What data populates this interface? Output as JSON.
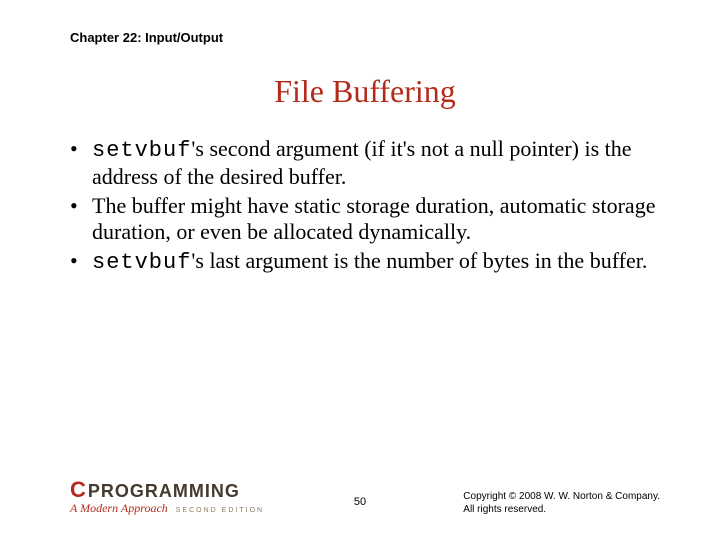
{
  "chapter_label": "Chapter 22: Input/Output",
  "title": "File Buffering",
  "bullets": [
    {
      "code1": "setvbuf",
      "rest1": "'s second argument (if it's not a null pointer) is the address of the desired buffer."
    },
    {
      "plain": "The buffer might have static storage duration, automatic storage duration, or even be allocated dynamically."
    },
    {
      "code1": "setvbuf",
      "rest1": "'s last argument is the number of bytes in the buffer."
    }
  ],
  "logo": {
    "c": "C",
    "programming": "PROGRAMMING",
    "approach": "A Modern Approach",
    "edition": "SECOND EDITION"
  },
  "page_number": "50",
  "copyright_line1": "Copyright © 2008 W. W. Norton & Company.",
  "copyright_line2": "All rights reserved."
}
